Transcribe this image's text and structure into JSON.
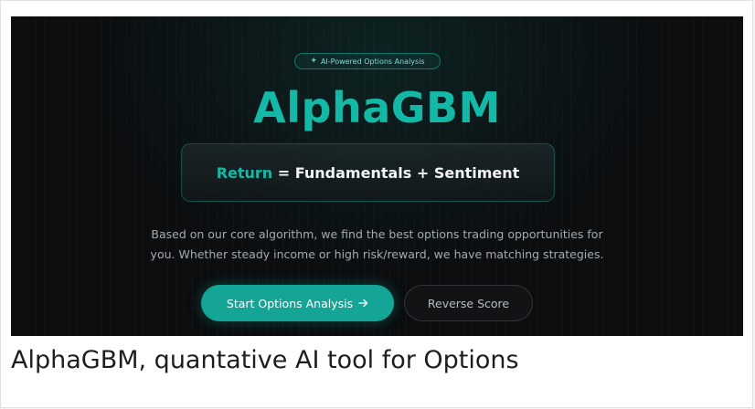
{
  "hero": {
    "badge_icon": "sparkles-icon",
    "badge_text": "AI-Powered Options Analysis",
    "brand_title": "AlphaGBM",
    "formula": {
      "accent_word": "Return",
      "rest": " = Fundamentals + Sentiment"
    },
    "description_line1": "Based on our core algorithm, we find the best options trading opportunities for",
    "description_line2": "you. Whether steady income or high risk/reward, we have matching strategies.",
    "primary_button_label": "Start Options Analysis",
    "primary_button_icon": "arrow-right-icon",
    "secondary_button_label": "Reverse Score"
  },
  "caption": "AlphaGBM, quantative AI tool for Options",
  "colors": {
    "accent": "#14b8a6",
    "hero_background": "#0b0d0f",
    "page_background": "#ffffff"
  }
}
